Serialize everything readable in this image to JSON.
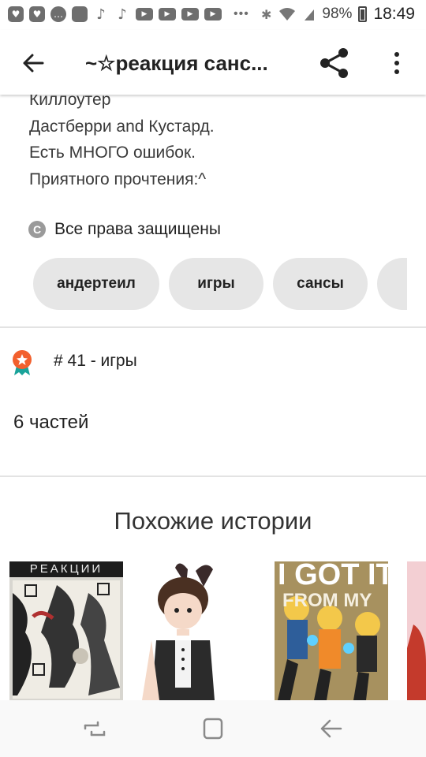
{
  "status_bar": {
    "battery": "98%",
    "time": "18:49",
    "notification_icons": [
      "heart-box-icon",
      "heart-box-icon",
      "chat-icon",
      "app-square-icon",
      "tiktok-icon",
      "tiktok-icon",
      "youtube-icon",
      "youtube-icon",
      "youtube-icon",
      "youtube-icon"
    ]
  },
  "app_bar": {
    "title": "~☆реакция санс...",
    "icons": [
      "back-arrow-icon",
      "share-icon",
      "more-vertical-icon"
    ]
  },
  "description": {
    "lines": [
      "Киллоутер",
      "Дастберри and Кустард.",
      "Есть МНОГО ошибок.",
      "Приятного прочтения:^"
    ]
  },
  "copyright": {
    "label": "Все права защищены",
    "icon_letter": "C"
  },
  "tags": [
    "андертеил",
    "игры",
    "сансы",
    ""
  ],
  "rank": {
    "text": "# 41 - игры",
    "icon": "award-badge-icon",
    "color": "#f2602d"
  },
  "parts_count": "6 частей",
  "similar": {
    "title": "Похожие истории",
    "covers": [
      {
        "title_text": "РЕАКЦИИ",
        "bg": "#2b2b2b"
      },
      {
        "title_text": "",
        "bg": "#ffffff"
      },
      {
        "title_text": "I GOT IT",
        "subtitle_text": "FROM MY",
        "bg": "#a7915f"
      },
      {
        "title_text": "",
        "bg": "#f3cfd3"
      }
    ]
  },
  "nav_bar": {
    "items": [
      "recents-icon",
      "home-icon",
      "back-icon"
    ]
  }
}
